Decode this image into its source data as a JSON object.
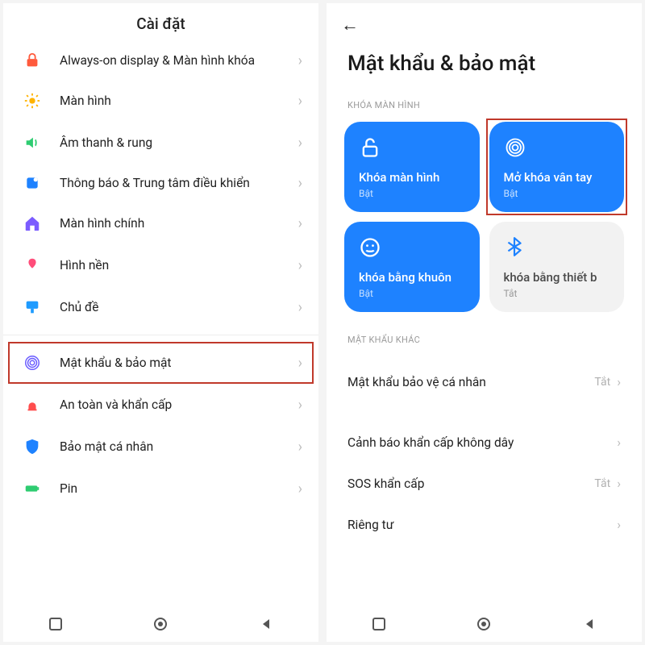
{
  "left": {
    "header": "Cài đặt",
    "items": [
      {
        "icon": "lock-red",
        "label": "Always-on display & Màn hình khóa"
      },
      {
        "icon": "sun",
        "label": "Màn hình"
      },
      {
        "icon": "volume",
        "label": "Âm thanh & rung"
      },
      {
        "icon": "bell",
        "label": "Thông báo & Trung tâm điều khiển"
      },
      {
        "icon": "home",
        "label": "Màn hình chính"
      },
      {
        "icon": "wallpaper",
        "label": "Hình nền"
      },
      {
        "icon": "theme",
        "label": "Chủ đề"
      },
      {
        "icon": "fingerprint",
        "label": "Mật khẩu & bảo mật"
      },
      {
        "icon": "alarm",
        "label": "An toàn và khẩn cấp"
      },
      {
        "icon": "shield",
        "label": "Bảo mật cá nhân"
      },
      {
        "icon": "battery",
        "label": "Pin"
      }
    ],
    "highlight_index": 7
  },
  "right": {
    "title": "Mật khẩu & bảo mật",
    "section1": "KHÓA MÀN HÌNH",
    "cards": [
      {
        "icon": "lock",
        "title": "Khóa màn hình",
        "status": "Bật",
        "on": true
      },
      {
        "icon": "fingerprint",
        "title": "Mở khóa vân tay",
        "status": "Bật",
        "on": true,
        "highlight": true
      },
      {
        "icon": "smile",
        "title": "khóa bằng khuôn",
        "status": "Bật",
        "on": true
      },
      {
        "icon": "bluetooth",
        "title": "khóa bằng thiết b",
        "status": "Tắt",
        "on": false
      }
    ],
    "section2": "MẬT KHẨU KHÁC",
    "rows": [
      {
        "label": "Mật khẩu bảo vệ cá nhân",
        "status": "Tắt"
      },
      {
        "label": "Cảnh báo khẩn cấp không dây",
        "status": ""
      },
      {
        "label": "SOS khẩn cấp",
        "status": "Tắt"
      },
      {
        "label": "Riêng tư",
        "status": ""
      }
    ]
  }
}
